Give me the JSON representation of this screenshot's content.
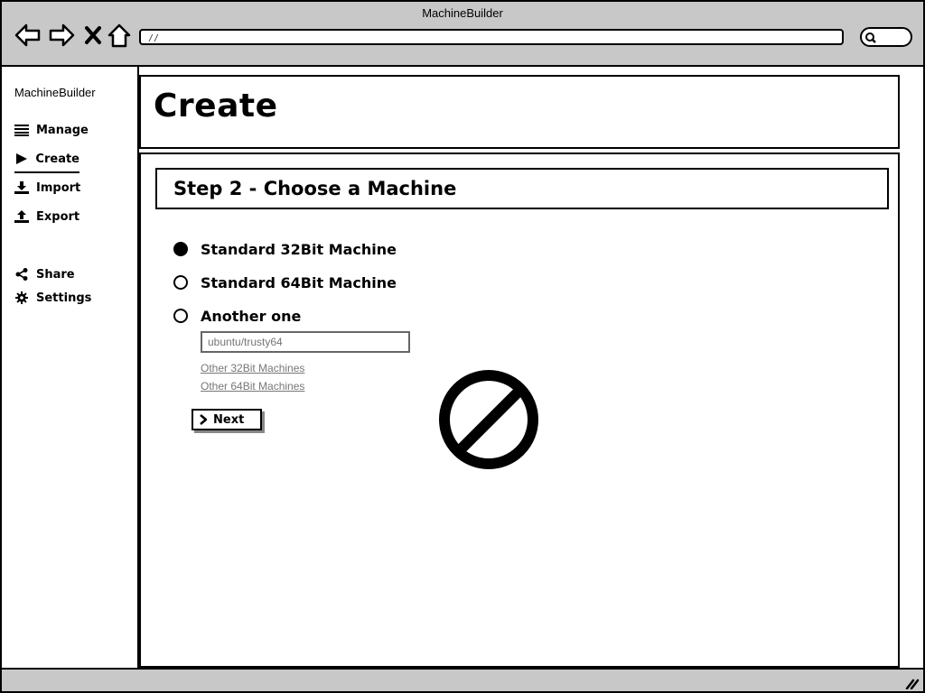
{
  "window": {
    "title": "MachineBuilder"
  },
  "browser": {
    "url": "//",
    "nav_icons": [
      "back-arrow-icon",
      "forward-arrow-icon",
      "close-x-icon",
      "home-icon",
      "search-icon"
    ]
  },
  "sidebar": {
    "brand": "MachineBuilder",
    "items": [
      {
        "label": "Manage",
        "icon": "list-icon"
      },
      {
        "label": "Create",
        "icon": "play-icon",
        "active": true
      },
      {
        "label": "Import",
        "icon": "download-icon"
      },
      {
        "label": "Export",
        "icon": "upload-icon"
      },
      {
        "label": "Share",
        "icon": "share-icon"
      },
      {
        "label": "Settings",
        "icon": "gear-icon"
      }
    ]
  },
  "header": {
    "title": "Create"
  },
  "main": {
    "step_title": "Step 2 - Choose a Machine",
    "options": [
      {
        "label": "Standard 32Bit Machine",
        "selected": true
      },
      {
        "label": "Standard 64Bit Machine",
        "selected": false
      },
      {
        "label": "Another one",
        "selected": false
      }
    ],
    "custom_input": {
      "placeholder": "ubuntu/trusty64"
    },
    "links": [
      "Other 32Bit Machines",
      "Other 64Bit Machines"
    ],
    "next_label": "Next",
    "overlay_icon": "prohibited-icon"
  }
}
